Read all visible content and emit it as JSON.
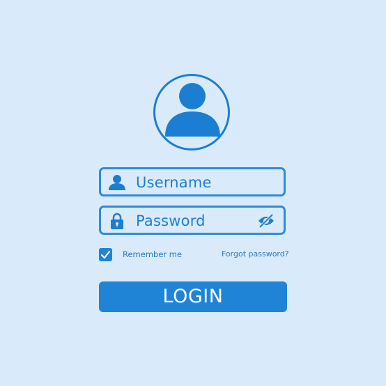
{
  "form": {
    "username_placeholder": "Username",
    "password_placeholder": "Password",
    "remember_label": "Remember me",
    "forgot_link": "Forgot password?",
    "login_label": "LOGIN",
    "remember_checked": true
  },
  "icons": {
    "avatar": "user-avatar-icon",
    "username": "user-icon",
    "password": "lock-icon",
    "visibility": "eye-slash-icon",
    "checkbox": "checkmark-icon"
  },
  "colors": {
    "background": "#d9ebfa",
    "accent": "#1f84d6",
    "text": "#1c7ed2",
    "link": "#2d78c0"
  }
}
